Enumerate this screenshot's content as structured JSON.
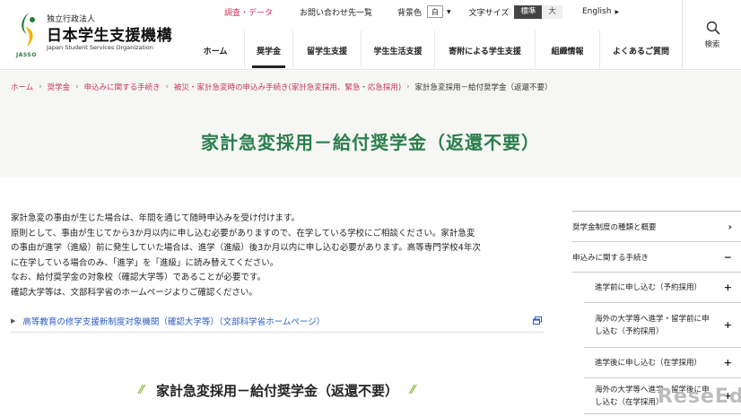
{
  "logo": {
    "small": "独立行政法人",
    "main": "日本学生支援機構",
    "english": "Japan Student Services Organization",
    "mark_text": "JASSO",
    "green": "#2a7a3a",
    "yellow": "#f0b400"
  },
  "utility": {
    "research": "調査・データ",
    "contact": "お問い合わせ先一覧",
    "bg_label": "背景色",
    "bg_value": "白",
    "font_label": "文字サイズ",
    "font_standard": "標準",
    "font_large": "大",
    "language": "English"
  },
  "search": {
    "label": "検索",
    "icon": "search-icon"
  },
  "nav": {
    "items": [
      {
        "label": "ホーム",
        "active": false
      },
      {
        "label": "奨学金",
        "active": true
      },
      {
        "label": "留学生支援",
        "active": false
      },
      {
        "label": "学生生活支援",
        "active": false
      },
      {
        "label": "寄附による学生支援",
        "active": false
      },
      {
        "label": "組織情報",
        "active": false
      },
      {
        "label": "よくあるご質問",
        "active": false
      }
    ]
  },
  "breadcrumb": {
    "links": [
      "ホーム",
      "奨学金",
      "申込みに関する手続き",
      "被災・家計急変時の申込み手続き(家計急変採用、緊急・応急採用)"
    ],
    "current": "家計急変採用－給付奨学金（返還不要）"
  },
  "page": {
    "title": "家計急変採用－給付奨学金（返還不要）",
    "title_color": "#2a7e4c"
  },
  "intro": {
    "lines": [
      "家計急変の事由が生じた場合は、年間を通じて随時申込みを受け付けます。",
      "原則として、事由が生じてから3か月以内に申し込む必要がありますので、在学している学校にご相談ください。家計急変",
      "の事由が進学（進級）前に発生していた場合は、進学（進級）後3か月以内に申し込む必要があります。高等専門学校4年次",
      "に在学している場合のみ、「進学」を「進級」に読み替えてください。",
      "なお、給付奨学金の対象校（確認大学等）であることが必要です。",
      "確認大学等は、文部科学省のホームページよりご確認ください。"
    ]
  },
  "external_link": {
    "text": "高等教育の修学支援新制度対象機関（確認大学等）（文部科学省ホームページ）",
    "color": "#2a5cc5"
  },
  "section": {
    "heading": "家計急変採用－給付奨学金（返還不要）"
  },
  "sidebar": {
    "items": [
      {
        "label": "奨学金制度の種類と概要",
        "mark": "›",
        "level": 1
      },
      {
        "label": "申込みに関する手続き",
        "mark": "−",
        "level": 1
      },
      {
        "label": "進学前に申し込む（予約採用）",
        "mark": "+",
        "level": 2
      },
      {
        "label": "海外の大学等へ進学・留学前に申し込む（予約採用）",
        "mark": "+",
        "level": 2
      },
      {
        "label": "進学後に申し込む（在学採用）",
        "mark": "+",
        "level": 2
      },
      {
        "label": "海外の大学等へ進学・留学後に申し込む（在学採用）",
        "mark": "+",
        "level": 2
      }
    ]
  },
  "watermark": "ReseEd",
  "accent": "#c8335f"
}
